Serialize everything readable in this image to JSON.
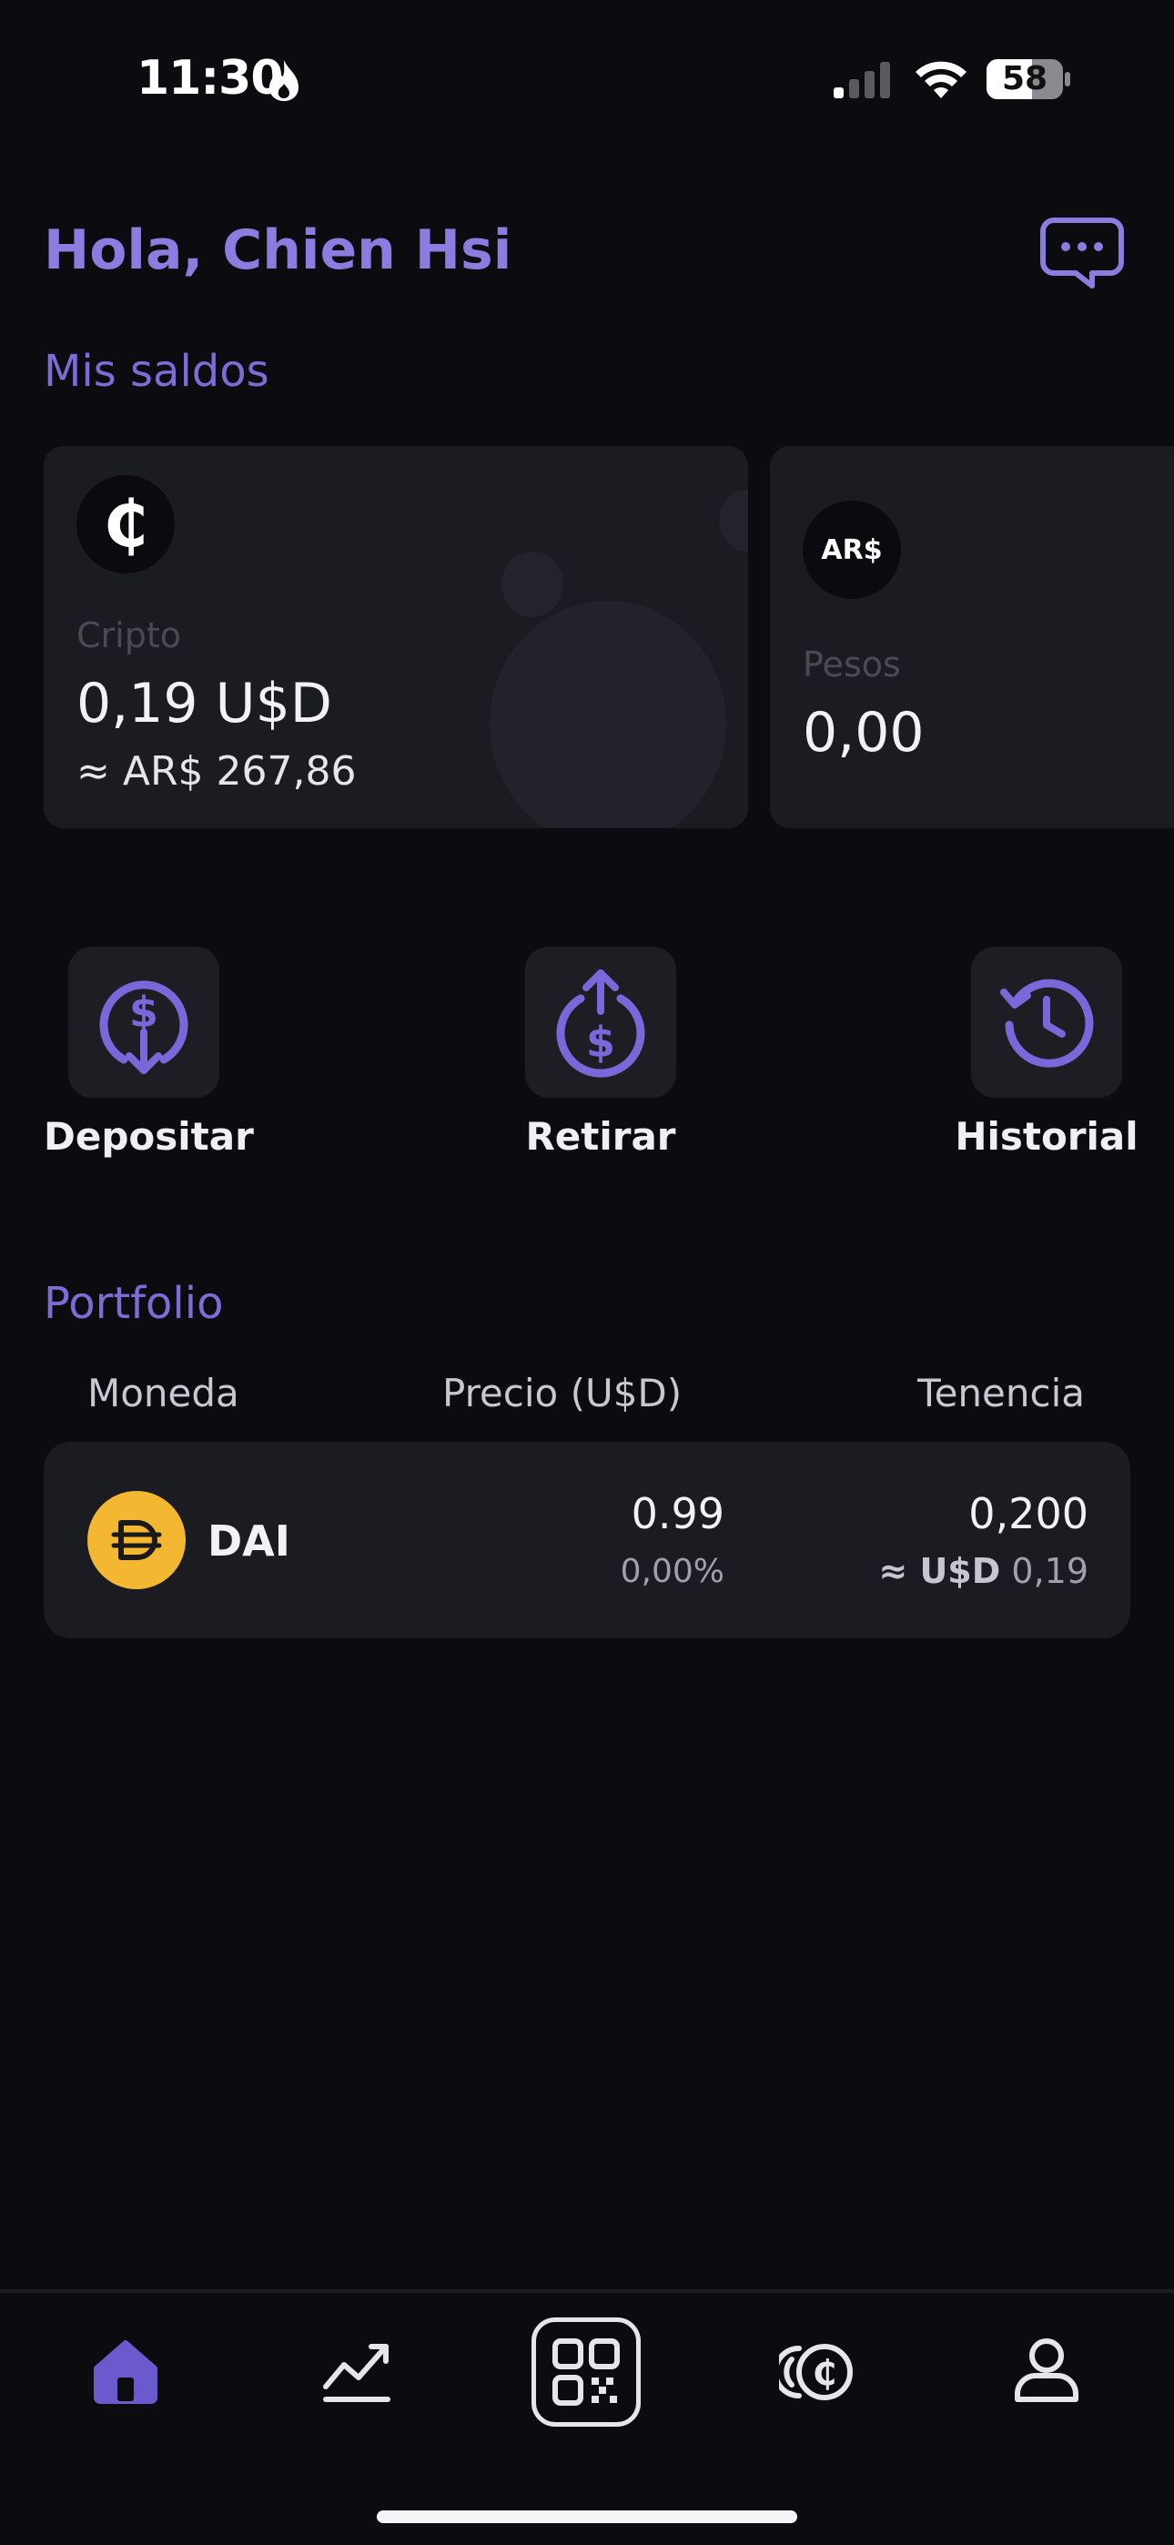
{
  "status_bar": {
    "time": "11:30",
    "battery": "58"
  },
  "header": {
    "greeting": "Hola, Chien Hsi",
    "chat_icon": "chat-bubble-icon"
  },
  "balances": {
    "title": "Mis saldos",
    "cards": [
      {
        "badge": "₵",
        "label": "Cripto",
        "value": "0,19 U$D",
        "sub": "≈ AR$ 267,86"
      },
      {
        "badge": "AR$",
        "label": "Pesos",
        "value": "0,00"
      }
    ]
  },
  "actions": [
    {
      "label": "Depositar",
      "icon": "deposit-icon"
    },
    {
      "label": "Retirar",
      "icon": "withdraw-icon"
    },
    {
      "label": "Historial",
      "icon": "history-icon"
    }
  ],
  "portfolio": {
    "title": "Portfolio",
    "columns": [
      "Moneda",
      "Precio (U$D)",
      "Tenencia"
    ],
    "rows": [
      {
        "coin": "DAI",
        "price": "0.99",
        "change": "0,00%",
        "holding": "0,200",
        "approx_prefix": "≈ U$D",
        "approx_value": "0,19"
      }
    ]
  },
  "nav": [
    "home-icon",
    "chart-icon",
    "qr-scan-icon",
    "coins-icon",
    "profile-icon"
  ],
  "colors": {
    "accent": "#7c6dd6",
    "background": "#0b0c10",
    "card": "#1b1b22",
    "dai": "#f4b731"
  }
}
